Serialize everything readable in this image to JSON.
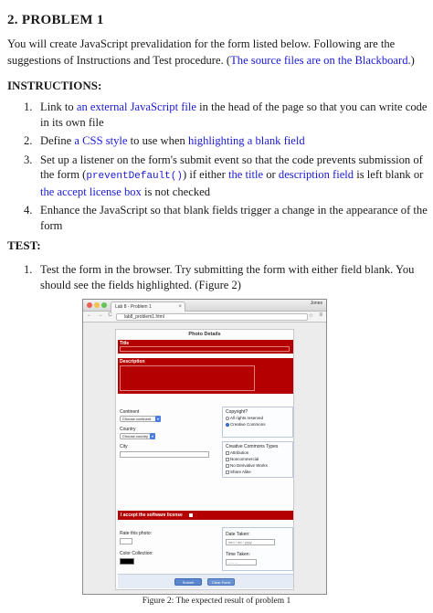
{
  "heading": "2. PROBLEM 1",
  "intro": {
    "text": "You will create JavaScript prevalidation for the form listed below. Following are the suggestions of Instructions and Test procedure. (",
    "link": "The source files are on the Blackboard.",
    "end": ")"
  },
  "instructions": {
    "heading": "INSTRUCTIONS:",
    "items": [
      {
        "num": "1.",
        "t1": "Link to ",
        "l1": "an external JavaScript file",
        "t2": " in the head of the page so that you can write code in its own file"
      },
      {
        "num": "2.",
        "t1": "Define ",
        "l1": "a CSS style",
        "t2": " to use when ",
        "l2": "highlighting a blank field"
      },
      {
        "num": "3.",
        "t1": "Set up a listener on the form's submit event so that the code prevents submission of the form (",
        "code": "preventDefault()",
        "t2": ") if either ",
        "l1": "the title",
        "t3": " or ",
        "l2": "description field",
        "t4": " is left blank or ",
        "l3": "the accept license box",
        "t5": " is not checked"
      },
      {
        "num": "4.",
        "t1": "Enhance the JavaScript so that blank fields trigger a change in the appearance of the form"
      }
    ]
  },
  "test": {
    "heading": "TEST:",
    "items": [
      {
        "num": "1.",
        "t1": "Test the form in the browser. Try submitting the form with either field blank. You should see the fields highlighted. (Figure 2)"
      }
    ]
  },
  "browser": {
    "tab_title": "Lab 8 - Problem 1",
    "tab_close": "×",
    "user": "Jones",
    "nav": "← → C",
    "address": "lab8_problem1.html",
    "form": {
      "title": "Photo Details",
      "title_label": "Title",
      "description_label": "Description",
      "continent_label": "Continent",
      "continent_value": "Choose continent",
      "country_label": "Country",
      "country_value": "Choose country",
      "city_label": "City",
      "copyright_label": "Copyright?",
      "copyright_options": [
        "All rights reserved",
        "Creative Commons"
      ],
      "cc_label": "Creative Commons Types",
      "cc_options": [
        "Attribution",
        "Noncommercial",
        "No Derivative Works",
        "Share Alike"
      ],
      "license_text": "I accept the software license",
      "rate_label": "Rate this photo:",
      "color_label": "Color Collection:",
      "date_label": "Date Taken:",
      "date_placeholder": "mm / dd / yyyy",
      "time_label": "Time Taken:",
      "time_placeholder": "--:-- --",
      "submit_label": "Submit",
      "clear_label": "Clear Form",
      "colors": {
        "error": "#b40000",
        "button": "#5b87cf",
        "radio_on": "#3b7be0"
      }
    }
  },
  "caption": "Figure 2: The expected result of problem 1"
}
